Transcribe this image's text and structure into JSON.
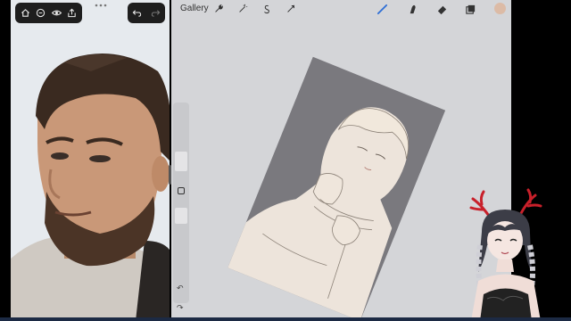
{
  "app": {
    "gallery_label": "Gallery"
  },
  "left_toolbar": {
    "icons": [
      "home-icon",
      "browser-icon",
      "eye-icon",
      "share-icon"
    ]
  },
  "left_undo": {
    "icons": [
      "undo-icon",
      "redo-icon"
    ]
  },
  "procreate_tools": {
    "icons": [
      "wrench-icon",
      "magic-wand-icon",
      "selection-icon",
      "transform-icon",
      "brush-icon",
      "smudge-icon",
      "eraser-icon",
      "layers-icon"
    ],
    "active_color": "#dcbba6",
    "accent": "#2f6fd6"
  },
  "sidebar": {
    "undo_glyph": "↶",
    "redo_glyph": "↷"
  }
}
